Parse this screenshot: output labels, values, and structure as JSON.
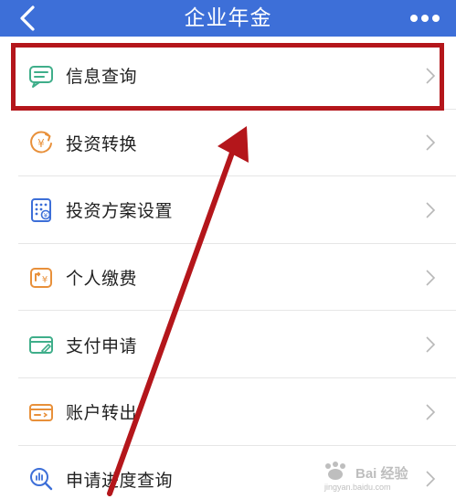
{
  "header": {
    "title": "企业年金",
    "back_icon": "chevron-left-icon",
    "more_icon": "more-dots-icon",
    "background_color": "#3d6fd8"
  },
  "menu": {
    "items": [
      {
        "label": "信息查询",
        "icon": "message-icon",
        "color": "#3fae8a"
      },
      {
        "label": "投资转换",
        "icon": "yuan-exchange-icon",
        "color": "#e8903a"
      },
      {
        "label": "投资方案设置",
        "icon": "calculator-icon",
        "color": "#3d6fd8"
      },
      {
        "label": "个人缴费",
        "icon": "yuan-payment-icon",
        "color": "#e8903a"
      },
      {
        "label": "支付申请",
        "icon": "card-icon",
        "color": "#3fae8a"
      },
      {
        "label": "账户转出",
        "icon": "wallet-out-icon",
        "color": "#e8903a"
      },
      {
        "label": "申请进度查询",
        "icon": "search-chart-icon",
        "color": "#3d6fd8"
      }
    ]
  },
  "annotation": {
    "color": "#b4161b"
  },
  "watermark": {
    "text": "Bai 经验",
    "sub": "jingyan.baidu.com"
  }
}
